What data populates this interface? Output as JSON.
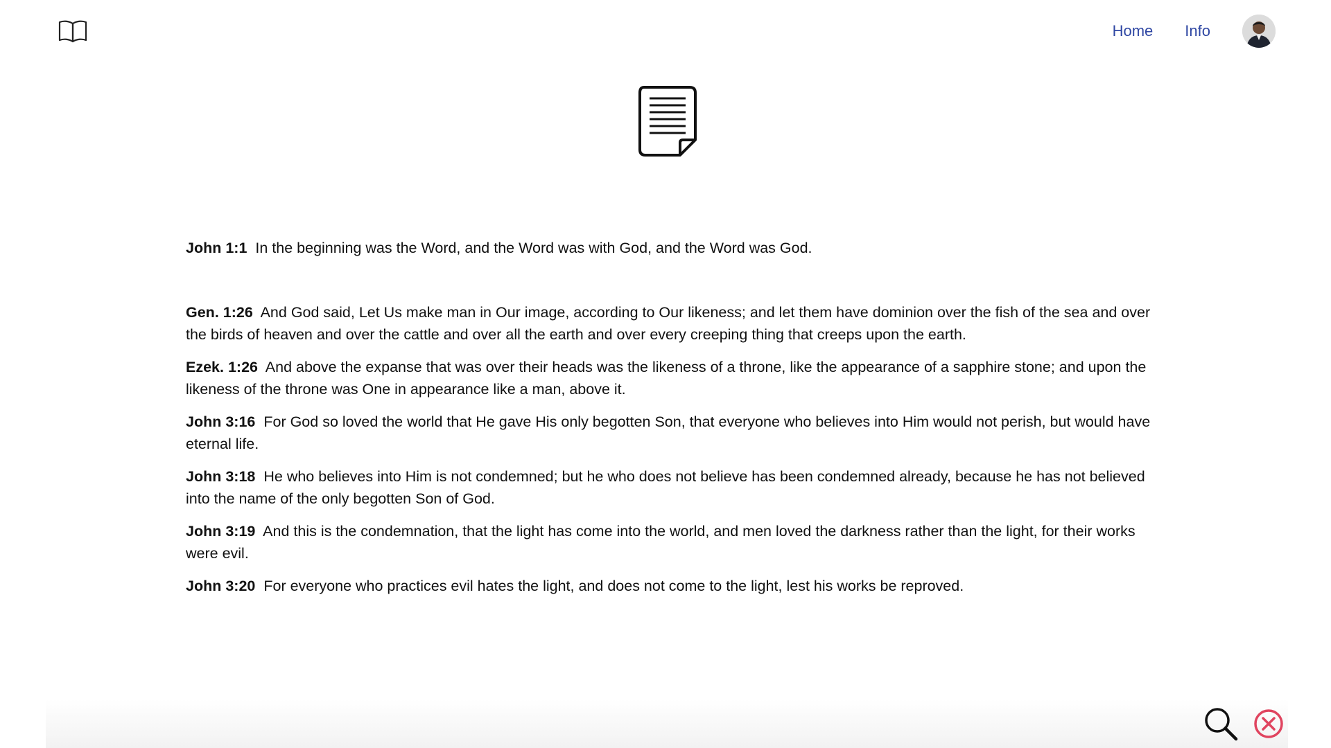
{
  "header": {
    "logo_icon": "open-book-icon",
    "nav": [
      {
        "label": "Home"
      },
      {
        "label": "Info"
      }
    ],
    "avatar_icon": "user-avatar"
  },
  "hero": {
    "icon": "document-icon"
  },
  "main_verse": {
    "ref": "John 1:1",
    "text": "In the beginning was the Word, and the Word was with God, and the Word was God."
  },
  "verses": [
    {
      "ref": "Gen. 1:26",
      "text": "And God said, Let Us make man in Our image, according to Our likeness; and let them have dominion over the fish of the sea and over the birds of heaven and over the cattle and over all the earth and over every creeping thing that creeps upon the earth."
    },
    {
      "ref": "Ezek. 1:26",
      "text": "And above the expanse that was over their heads was the likeness of a throne, like the appearance of a sapphire stone; and upon the likeness of the throne was One in appearance like a man, above it."
    },
    {
      "ref": "John 3:16",
      "text": "For God so loved the world that He gave His only begotten Son, that everyone who believes into Him would not perish, but would have eternal life."
    },
    {
      "ref": "John 3:18",
      "text": "He who believes into Him is not condemned; but he who does not believe has been condemned already, because he has not believed into the name of the only begotten Son of God."
    },
    {
      "ref": "John 3:19",
      "text": "And this is the condemnation, that the light has come into the world, and men loved the darkness rather than the light, for their works were evil."
    },
    {
      "ref": "John 3:20",
      "text": "For everyone who practices evil hates the light, and does not come to the light, lest his works be reproved."
    }
  ],
  "footer": {
    "search_icon": "search-icon",
    "close_icon": "close-circle-icon"
  },
  "colors": {
    "link": "#2f47a3",
    "close": "#e0445f",
    "text": "#111111"
  }
}
